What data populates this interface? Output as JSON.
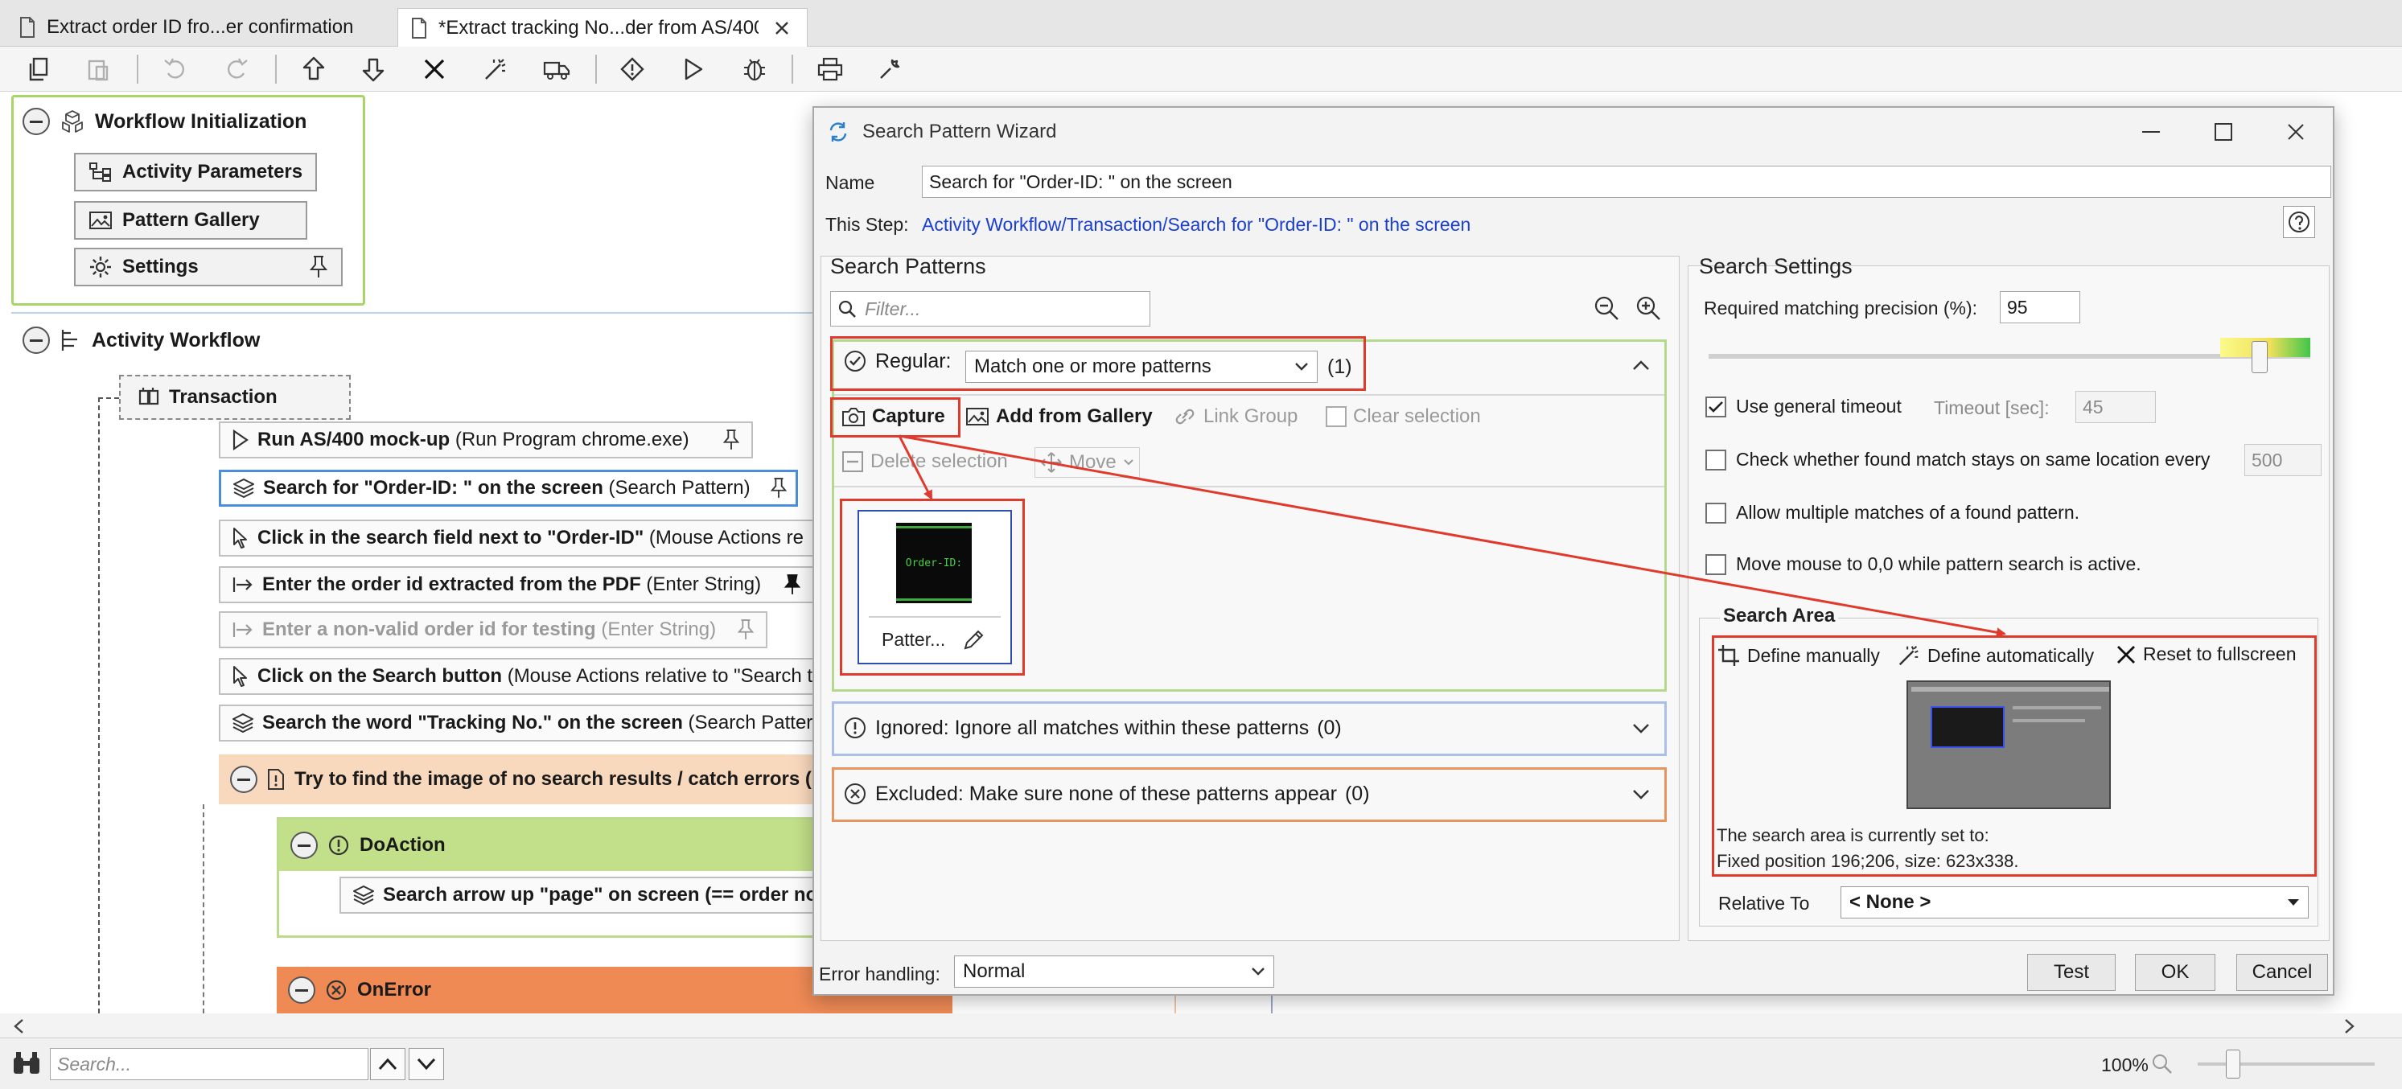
{
  "tabs": [
    {
      "label": "Extract order ID fro...er confirmation",
      "active": false
    },
    {
      "label": "*Extract tracking No...der from AS/400",
      "active": true
    }
  ],
  "toolbar": {
    "icons": [
      "copy-icon",
      "paste-icon",
      "undo-icon",
      "redo-icon",
      "move-up-icon",
      "move-down-icon",
      "delete-icon",
      "magic-wand-icon",
      "delivery-truck-icon",
      "breakpoint-icon",
      "run-icon",
      "debug-icon",
      "print-icon",
      "wrench-icon"
    ]
  },
  "workflow": {
    "init": {
      "title": "Workflow Initialization",
      "buttons": [
        "Activity Parameters",
        "Pattern Gallery",
        "Settings"
      ]
    },
    "activity_title": "Activity Workflow",
    "transaction_label": "Transaction",
    "steps": [
      {
        "bold": "Run AS/400 mock-up",
        "sub": " (Run Program chrome.exe)"
      },
      {
        "bold": "Search for \"Order-ID: \" on the screen",
        "sub": " (Search Pattern)"
      },
      {
        "bold": "Click in the search field next to \"Order-ID\"",
        "sub": " (Mouse Actions re"
      },
      {
        "bold": "Enter the order id extracted from the PDF",
        "sub": " (Enter String)"
      },
      {
        "bold": "Enter a non-valid order id for testing",
        "sub": " (Enter String)"
      },
      {
        "bold": "Click on the Search button",
        "sub": " (Mouse Actions relative to \"Search t"
      },
      {
        "bold": "Search the word \"Tracking No.\" on the screen",
        "sub": " (Search Pattern"
      }
    ],
    "try_label": "Try to find the image of no search results / catch errors (",
    "do_label": "DoAction",
    "do_child": "Search arrow up \"page\" on screen (== order no",
    "error_label": "OnError"
  },
  "dialog": {
    "title": "Search Pattern Wizard",
    "name_label": "Name",
    "name_value": "Search for \"Order-ID: \" on the screen",
    "step_label": "This Step:",
    "step_link": "Activity Workflow/Transaction/Search for \"Order-ID: \" on the screen",
    "patterns_title": "Search Patterns",
    "filter_placeholder": "Filter...",
    "regular": {
      "label": "Regular:",
      "mode": "Match one or more patterns",
      "count": "(1)",
      "capture": "Capture",
      "add_gallery": "Add from Gallery",
      "link_group": "Link Group",
      "clear_selection": "Clear selection",
      "delete_selection": "Delete selection",
      "move": "Move",
      "thumb_label": "Patter...",
      "thumb_text": "Order-ID:"
    },
    "ignored_label": "Ignored: Ignore all matches within these patterns",
    "ignored_count": "(0)",
    "excluded_label": "Excluded: Make sure none of these patterns appear",
    "excluded_count": "(0)",
    "settings": {
      "title": "Search Settings",
      "precision_label": "Required matching precision (%):",
      "precision_value": "95",
      "slider_value": 95,
      "general_timeout": "Use general timeout",
      "timeout_label": "Timeout [sec]:",
      "timeout_value": "45",
      "same_location": "Check whether found match stays on same location every",
      "same_location_value": "500",
      "multiple_matches": "Allow multiple matches of a found pattern.",
      "move_mouse": "Move mouse to 0,0 while pattern search is active."
    },
    "search_area": {
      "title": "Search Area",
      "define_manually": "Define manually",
      "define_automatically": "Define automatically",
      "reset": "Reset to fullscreen",
      "status_line1": "The search area is currently set to:",
      "status_line2": "Fixed position 196;206, size: 623x338.",
      "relative_label": "Relative To",
      "relative_value": "< None >"
    },
    "error_handling_label": "Error handling:",
    "error_handling_value": "Normal",
    "buttons": {
      "test": "Test",
      "ok": "OK",
      "cancel": "Cancel"
    }
  },
  "status": {
    "search_placeholder": "Search...",
    "zoom": "100%",
    "zoom_level": 100
  },
  "colors": {
    "highlight_red": "#e03a2c",
    "init_green": "#a8d46a",
    "selected_blue": "#4a8fd8",
    "link_blue": "#1a3fd0",
    "try_orange": "#f9d9bd",
    "do_green": "#c2e08a",
    "error_orange": "#ef8a55"
  }
}
